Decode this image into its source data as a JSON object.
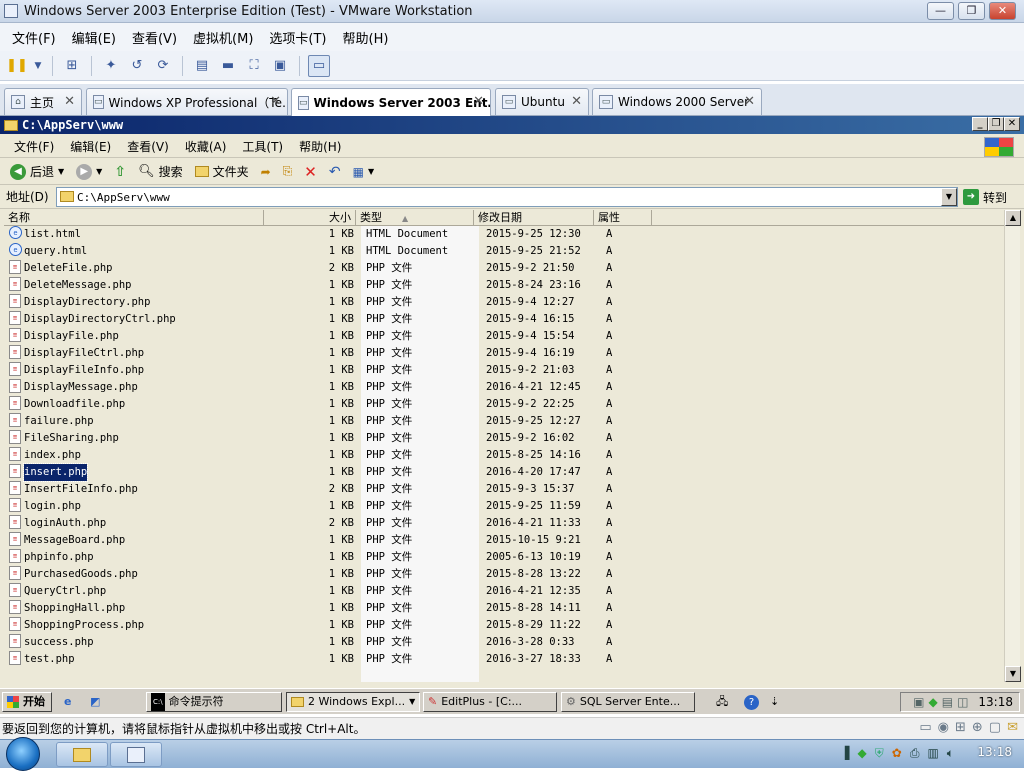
{
  "vmware": {
    "title": "Windows Server 2003 Enterprise Edition (Test) - VMware Workstation",
    "window_buttons": [
      "—",
      "❐",
      "✕"
    ],
    "menu": [
      "文件(F)",
      "编辑(E)",
      "查看(V)",
      "虚拟机(M)",
      "选项卡(T)",
      "帮助(H)"
    ],
    "tabs": [
      {
        "label": "主页"
      },
      {
        "label": "Windows XP Professional（Te…"
      },
      {
        "label": "Windows Server 2003 Ent…"
      },
      {
        "label": "Ubuntu"
      },
      {
        "label": "Windows 2000 Server"
      }
    ],
    "active_tab": 2,
    "status_text": "要返回到您的计算机，请将鼠标指针从虚拟机中移出或按 Ctrl+Alt。"
  },
  "explorer": {
    "title": "C:\\AppServ\\www",
    "menu": [
      "文件(F)",
      "编辑(E)",
      "查看(V)",
      "收藏(A)",
      "工具(T)",
      "帮助(H)"
    ],
    "toolbar": {
      "back": "后退",
      "search": "搜索",
      "folders": "文件夹"
    },
    "address_label": "地址(D)",
    "address_value": "C:\\AppServ\\www",
    "go_label": "转到",
    "columns": [
      "名称",
      "大小",
      "类型",
      "修改日期",
      "属性"
    ],
    "selected_row": 14,
    "files": [
      {
        "name": "list.html",
        "size": "1 KB",
        "type": "HTML Document",
        "date": "2015-9-25 12:30",
        "attr": "A",
        "kind": "html"
      },
      {
        "name": "query.html",
        "size": "1 KB",
        "type": "HTML Document",
        "date": "2015-9-25 21:52",
        "attr": "A",
        "kind": "html"
      },
      {
        "name": "DeleteFile.php",
        "size": "2 KB",
        "type": "PHP 文件",
        "date": "2015-9-2 21:50",
        "attr": "A",
        "kind": "php"
      },
      {
        "name": "DeleteMessage.php",
        "size": "1 KB",
        "type": "PHP 文件",
        "date": "2015-8-24 23:16",
        "attr": "A",
        "kind": "php"
      },
      {
        "name": "DisplayDirectory.php",
        "size": "1 KB",
        "type": "PHP 文件",
        "date": "2015-9-4 12:27",
        "attr": "A",
        "kind": "php"
      },
      {
        "name": "DisplayDirectoryCtrl.php",
        "size": "1 KB",
        "type": "PHP 文件",
        "date": "2015-9-4 16:15",
        "attr": "A",
        "kind": "php"
      },
      {
        "name": "DisplayFile.php",
        "size": "1 KB",
        "type": "PHP 文件",
        "date": "2015-9-4 15:54",
        "attr": "A",
        "kind": "php"
      },
      {
        "name": "DisplayFileCtrl.php",
        "size": "1 KB",
        "type": "PHP 文件",
        "date": "2015-9-4 16:19",
        "attr": "A",
        "kind": "php"
      },
      {
        "name": "DisplayFileInfo.php",
        "size": "1 KB",
        "type": "PHP 文件",
        "date": "2015-9-2 21:03",
        "attr": "A",
        "kind": "php"
      },
      {
        "name": "DisplayMessage.php",
        "size": "1 KB",
        "type": "PHP 文件",
        "date": "2016-4-21 12:45",
        "attr": "A",
        "kind": "php"
      },
      {
        "name": "Downloadfile.php",
        "size": "1 KB",
        "type": "PHP 文件",
        "date": "2015-9-2 22:25",
        "attr": "A",
        "kind": "php"
      },
      {
        "name": "failure.php",
        "size": "1 KB",
        "type": "PHP 文件",
        "date": "2015-9-25 12:27",
        "attr": "A",
        "kind": "php"
      },
      {
        "name": "FileSharing.php",
        "size": "1 KB",
        "type": "PHP 文件",
        "date": "2015-9-2 16:02",
        "attr": "A",
        "kind": "php"
      },
      {
        "name": "index.php",
        "size": "1 KB",
        "type": "PHP 文件",
        "date": "2015-8-25 14:16",
        "attr": "A",
        "kind": "php"
      },
      {
        "name": "insert.php",
        "size": "1 KB",
        "type": "PHP 文件",
        "date": "2016-4-20 17:47",
        "attr": "A",
        "kind": "php"
      },
      {
        "name": "InsertFileInfo.php",
        "size": "2 KB",
        "type": "PHP 文件",
        "date": "2015-9-3 15:37",
        "attr": "A",
        "kind": "php"
      },
      {
        "name": "login.php",
        "size": "1 KB",
        "type": "PHP 文件",
        "date": "2015-9-25 11:59",
        "attr": "A",
        "kind": "php"
      },
      {
        "name": "loginAuth.php",
        "size": "2 KB",
        "type": "PHP 文件",
        "date": "2016-4-21 11:33",
        "attr": "A",
        "kind": "php"
      },
      {
        "name": "MessageBoard.php",
        "size": "1 KB",
        "type": "PHP 文件",
        "date": "2015-10-15 9:21",
        "attr": "A",
        "kind": "php"
      },
      {
        "name": "phpinfo.php",
        "size": "1 KB",
        "type": "PHP 文件",
        "date": "2005-6-13 10:19",
        "attr": "A",
        "kind": "php"
      },
      {
        "name": "PurchasedGoods.php",
        "size": "1 KB",
        "type": "PHP 文件",
        "date": "2015-8-28 13:22",
        "attr": "A",
        "kind": "php"
      },
      {
        "name": "QueryCtrl.php",
        "size": "1 KB",
        "type": "PHP 文件",
        "date": "2016-4-21 12:35",
        "attr": "A",
        "kind": "php"
      },
      {
        "name": "ShoppingHall.php",
        "size": "1 KB",
        "type": "PHP 文件",
        "date": "2015-8-28 14:11",
        "attr": "A",
        "kind": "php"
      },
      {
        "name": "ShoppingProcess.php",
        "size": "1 KB",
        "type": "PHP 文件",
        "date": "2015-8-29 11:22",
        "attr": "A",
        "kind": "php"
      },
      {
        "name": "success.php",
        "size": "1 KB",
        "type": "PHP 文件",
        "date": "2016-3-28 0:33",
        "attr": "A",
        "kind": "php"
      },
      {
        "name": "test.php",
        "size": "1 KB",
        "type": "PHP 文件",
        "date": "2016-3-27 18:33",
        "attr": "A",
        "kind": "php"
      }
    ]
  },
  "guest_taskbar": {
    "start": "开始",
    "buttons": [
      "命令提示符",
      "2 Windows Expl...",
      "EditPlus - [C:...",
      "SQL Server Ente..."
    ],
    "clock": "13:18"
  },
  "host_taskbar": {
    "clock": "13:18"
  }
}
